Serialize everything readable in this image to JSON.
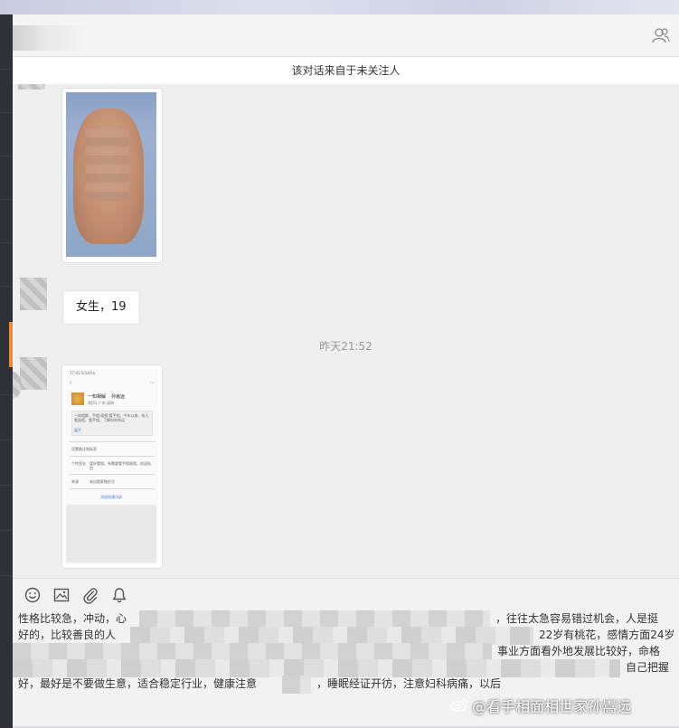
{
  "notice": {
    "text": "该对话来自于未关注人"
  },
  "messages": {
    "bubble_text": "女生，19",
    "timestamp": "昨天21:52"
  },
  "phone_screenshot": {
    "status": "17:01 5/14/5n",
    "profile_name": "一知相解",
    "profile_name2": "孙嵩远",
    "profile_sub": "男|51 广东·深圳",
    "bio": "一知相解，手相·面相·看手相，今年以来，给人看面相，看手相，了解你的命运",
    "bio_link": "展开",
    "row1": "设置备注和标签",
    "row2_label": "个性签名",
    "row2_value": "爱好看相，有需要看手相面相，欢迎私信",
    "row3_label": "来源",
    "row3_value": "来自搜索微信号",
    "button": "添加到通讯录"
  },
  "toolbar": {
    "icons": [
      "emoji-icon",
      "image-icon",
      "attachment-icon",
      "bell-icon"
    ]
  },
  "input": {
    "line1_start": "性格比较急，冲动，心",
    "line1_end": "，往往太急容易错过机会，人是挺",
    "line2_start": "好的，比较善良的人",
    "line2_end": "22岁有桃花，感情方面24岁",
    "line3_end": "事业方面看外地发展比较好，命格",
    "line4_end": "自己把握",
    "line5_start": "好，最好是不要做生意，适合稳定行业，健康注意",
    "line5_end": "，睡眠经证开彷，注意妇科病痛，以后"
  },
  "watermark": {
    "text": "@看手相面相世家孙嵩远"
  }
}
